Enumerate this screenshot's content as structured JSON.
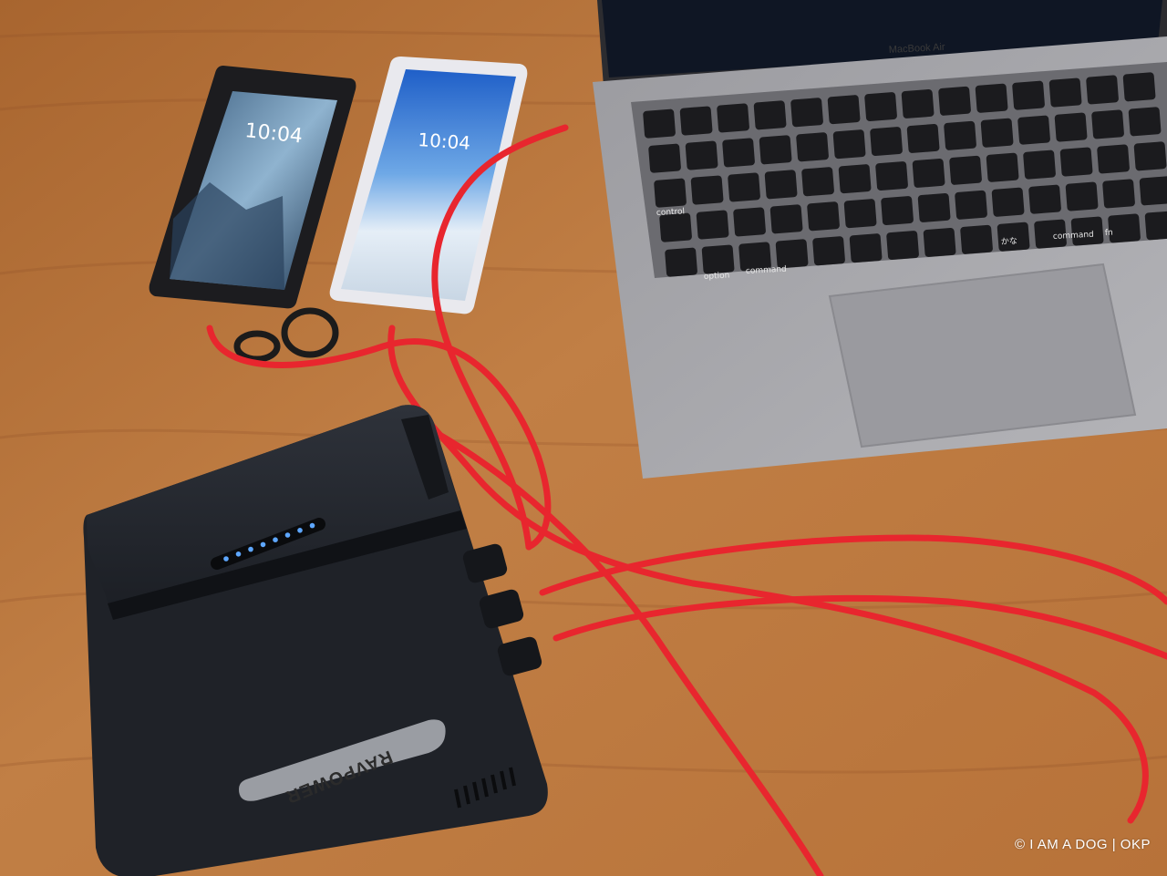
{
  "phone_left": {
    "time": "10:04"
  },
  "phone_right": {
    "time": "10:04"
  },
  "laptop": {
    "model_label": "MacBook Air",
    "key_labels": [
      "control",
      "option",
      "command",
      "command",
      "fn",
      "かな"
    ]
  },
  "power_bank": {
    "brand": "RAVPOWER",
    "indicator_leds": 8
  },
  "watermark": "© I AM A DOG | OKP",
  "colors": {
    "table_wood": "#b9773f",
    "cable_red": "#e8262e",
    "laptop_silver": "#a7a7ab",
    "power_bank_black": "#1f2228",
    "led_blue": "#5ea7ff"
  }
}
